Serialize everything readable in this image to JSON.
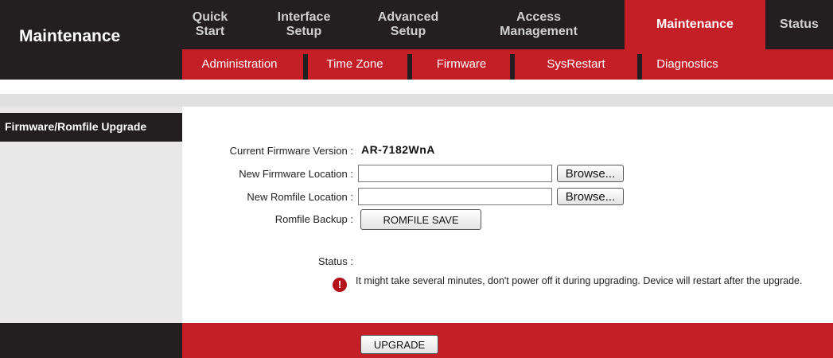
{
  "brand": {
    "title": "Maintenance"
  },
  "nav": {
    "tabs": [
      {
        "label": "Quick Start"
      },
      {
        "label": "Interface Setup"
      },
      {
        "label": "Advanced Setup"
      },
      {
        "label": "Access Management"
      },
      {
        "label": "Maintenance",
        "active": true
      },
      {
        "label": "Status"
      }
    ],
    "subtabs": [
      {
        "label": "Administration"
      },
      {
        "label": "Time Zone"
      },
      {
        "label": "Firmware"
      },
      {
        "label": "SysRestart"
      },
      {
        "label": "Diagnostics"
      }
    ]
  },
  "section": {
    "title": "Firmware/Romfile Upgrade"
  },
  "form": {
    "current_version_label": "Current Firmware Version :",
    "current_version_value": "AR-7182WnA",
    "new_firmware_label": "New Firmware Location :",
    "new_firmware_value": "",
    "new_romfile_label": "New Romfile Location :",
    "new_romfile_value": "",
    "browse_label": "Browse...",
    "romfile_backup_label": "Romfile Backup :",
    "romfile_save_label": "ROMFILE SAVE",
    "status_label": "Status :",
    "warning_text": "It might take several minutes, don't power off it during upgrading. Device will restart after the upgrade."
  },
  "footer": {
    "upgrade_label": "UPGRADE"
  },
  "colors": {
    "accent_red": "#c41e26",
    "dark": "#231f20",
    "gray": "#e8e8e8"
  }
}
